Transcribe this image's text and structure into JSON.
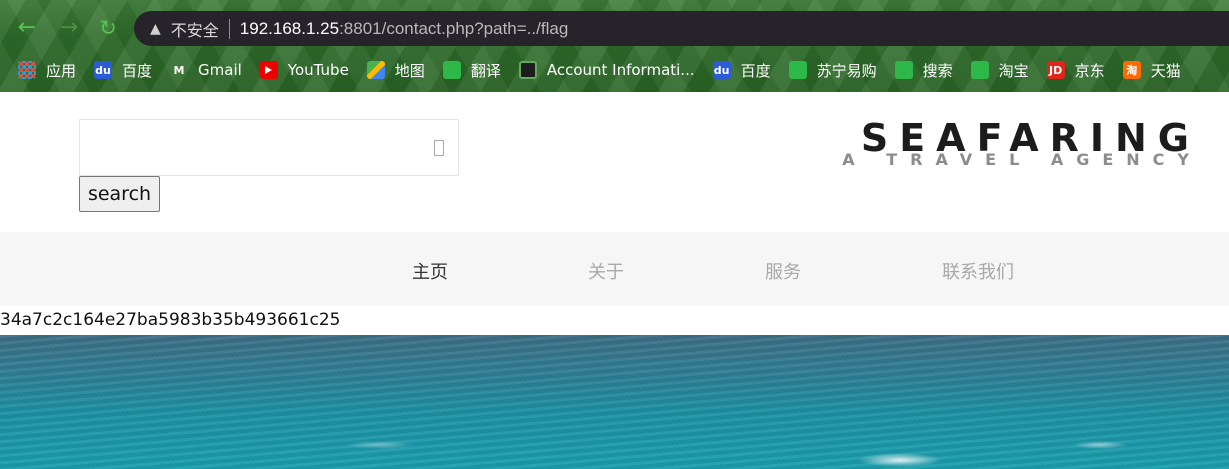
{
  "browser": {
    "nav": {
      "back_icon": "←",
      "forward_icon": "→",
      "reload_icon": "↻"
    },
    "address_bar": {
      "warning_icon": "▲",
      "security_label": "不安全",
      "url_host": "192.168.1.25",
      "url_rest": ":8801/contact.php?path=../flag"
    },
    "bookmarks": [
      {
        "label": "应用",
        "icon": "apps-icon",
        "glyph": ""
      },
      {
        "label": "百度",
        "icon": "baidu-icon",
        "glyph": "du"
      },
      {
        "label": "Gmail",
        "icon": "gmail-icon",
        "glyph": "M"
      },
      {
        "label": "YouTube",
        "icon": "youtube-icon",
        "glyph": ""
      },
      {
        "label": "地图",
        "icon": "maps-icon",
        "glyph": ""
      },
      {
        "label": "翻译",
        "icon": "globe-icon",
        "glyph": ""
      },
      {
        "label": "Account Informati...",
        "icon": "account-icon",
        "glyph": ""
      },
      {
        "label": "百度",
        "icon": "baidu-icon",
        "glyph": "du"
      },
      {
        "label": "苏宁易购",
        "icon": "globe-icon",
        "glyph": ""
      },
      {
        "label": "搜索",
        "icon": "globe-icon",
        "glyph": ""
      },
      {
        "label": "淘宝",
        "icon": "globe-icon",
        "glyph": ""
      },
      {
        "label": "京东",
        "icon": "jd-icon",
        "glyph": "JD"
      },
      {
        "label": "天猫",
        "icon": "taobao-icon",
        "glyph": "淘"
      }
    ]
  },
  "page": {
    "search": {
      "input_value": "",
      "button_label": "search",
      "glyph": ""
    },
    "logo": {
      "title": "SEAFARING",
      "subtitle": "A TRAVEL AGENCY"
    },
    "nav": [
      {
        "label": "主页",
        "active": true
      },
      {
        "label": "关于",
        "active": false
      },
      {
        "label": "服务",
        "active": false
      },
      {
        "label": "联系我们",
        "active": false
      }
    ],
    "flag_output": "34a7c2c164e27ba5983b35b493661c25"
  },
  "colors": {
    "chrome_green": "#2f6d2b",
    "omnibox": "#26232a",
    "nav_bg": "#f6f6f6",
    "sea": "#1d93a6"
  }
}
